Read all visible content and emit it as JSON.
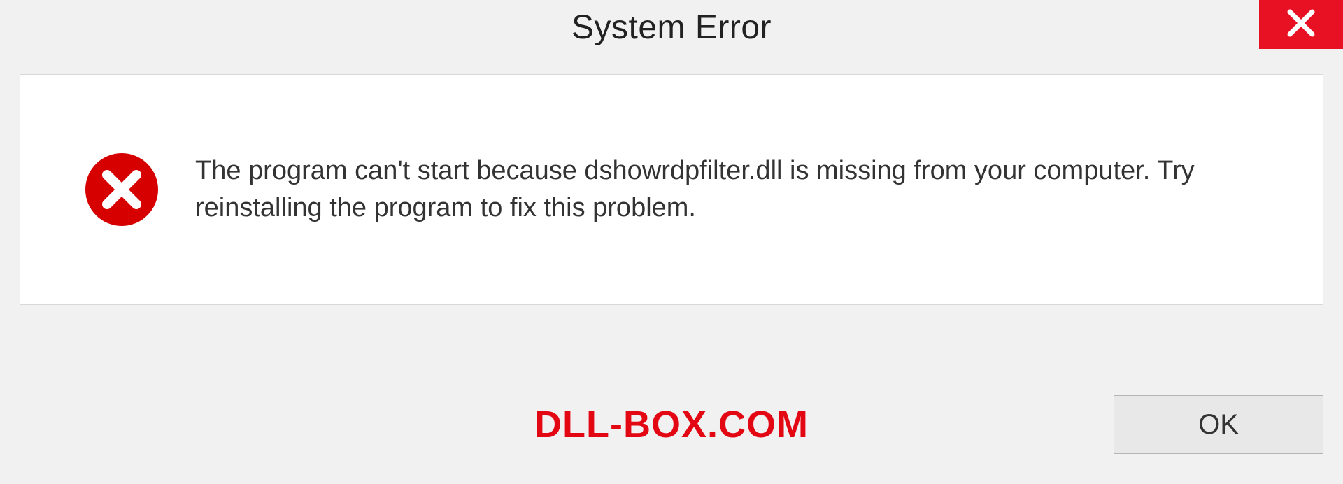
{
  "dialog": {
    "title": "System Error",
    "message": "The program can't start because dshowrdpfilter.dll is missing from your computer. Try reinstalling the program to fix this problem.",
    "ok_label": "OK"
  },
  "watermark": "DLL-BOX.COM",
  "colors": {
    "close_bg": "#e81123",
    "error_icon": "#d60000",
    "watermark": "#e30613"
  }
}
